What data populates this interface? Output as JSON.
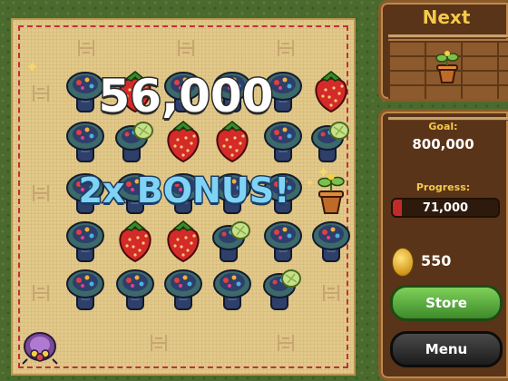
{
  "game": {
    "score_popup": "56,000",
    "bonus_popup": "2x BONUS!"
  },
  "side_panel": {
    "next_label": "Next",
    "next_piece": "flower-pot",
    "goal_label": "Goal:",
    "goal_value": "800,000",
    "progress_label": "Progress:",
    "progress_value": "71,000",
    "progress_fraction": 0.0888,
    "coins": "550",
    "store_button": "Store",
    "menu_button": "Menu"
  },
  "board": {
    "pieces": [
      [
        "mushroom",
        "strawberry",
        "mushroom",
        "mushroom",
        "mushroom",
        "strawberry"
      ],
      [
        "mushroom",
        "mushroom-sprout",
        "strawberry",
        "strawberry",
        "mushroom",
        "mushroom-sprout"
      ],
      [
        "mushroom",
        "mushroom",
        "mushroom",
        "mushroom",
        "mushroom",
        "flower-pot"
      ],
      [
        "mushroom",
        "strawberry",
        "strawberry",
        "mushroom-sprout",
        "mushroom",
        "mushroom"
      ],
      [
        "mushroom",
        "mushroom",
        "mushroom",
        "mushroom",
        "mushroom-sprout",
        ""
      ]
    ],
    "corner_piece": "purple-beetle"
  },
  "colors": {
    "score_text": "#ffffff",
    "bonus_text": "#7fd3f5",
    "panel_label": "#f4c94a",
    "progress_fill": "#c22a2a",
    "store_green": "#3d8a2a",
    "menu_dark": "#1c1c1c"
  }
}
